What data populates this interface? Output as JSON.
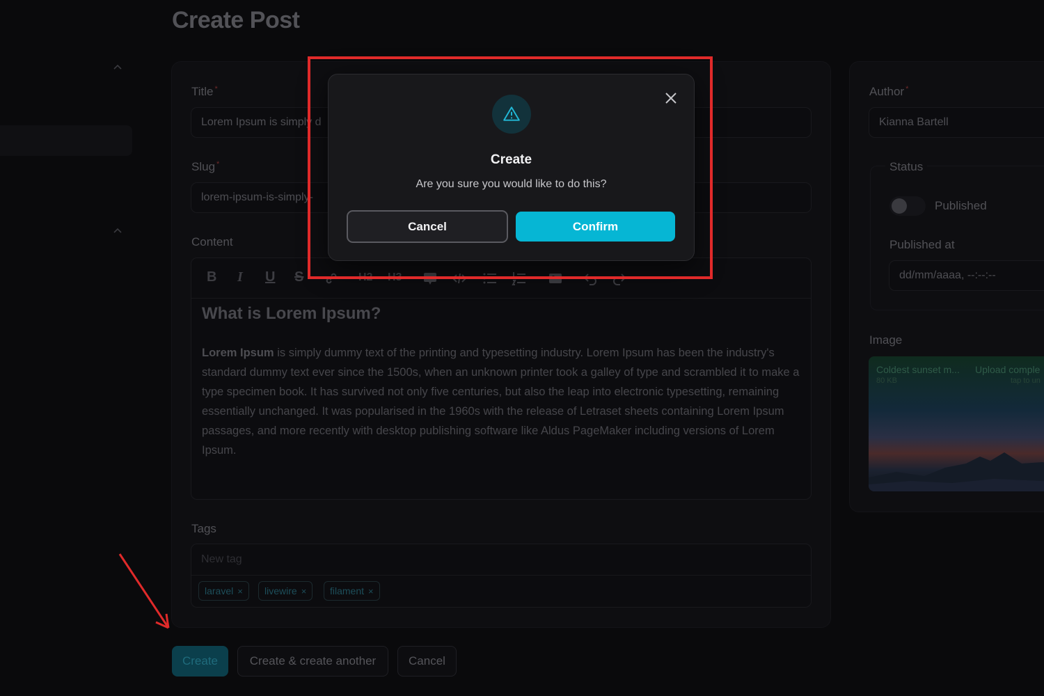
{
  "page": {
    "title": "Create Post"
  },
  "form": {
    "title_label": "Title",
    "title_value": "Lorem Ipsum is simply d",
    "slug_label": "Slug",
    "slug_value": "lorem-ipsum-is-simply-",
    "content_label": "Content",
    "content_heading": "What is Lorem Ipsum?",
    "content_lead": "Lorem Ipsum",
    "content_body": " is simply dummy text of the printing and typesetting industry. Lorem Ipsum has been the industry's standard dummy text ever since the 1500s, when an unknown printer took a galley of type and scrambled it to make a type specimen book. It has survived not only five centuries, but also the leap into electronic typesetting, remaining essentially unchanged. It was popularised in the 1960s with the release of Letraset sheets containing Lorem Ipsum passages, and more recently with desktop publishing software like Aldus PageMaker including versions of Lorem Ipsum.",
    "tags_label": "Tags",
    "tags_placeholder": "New tag",
    "tags": [
      "laravel",
      "livewire",
      "filament"
    ],
    "tag_remove": "×"
  },
  "toolbar": {
    "bold": "B",
    "italic": "I",
    "underline": "U",
    "strike": "S",
    "h2": "H2",
    "h3": "H3"
  },
  "sidebar_panel": {
    "author_label": "Author",
    "author_value": "Kianna Bartell",
    "status_label": "Status",
    "published_label": "Published",
    "published_at_label": "Published at",
    "published_at_placeholder": "dd/mm/aaaa, --:--:--",
    "image_label": "Image",
    "image_file_name": "Coldest sunset m...",
    "image_file_size": "80 KB",
    "image_upload_status": "Upload comple",
    "image_upload_hint": "tap to un"
  },
  "actions": {
    "create": "Create",
    "create_another": "Create & create another",
    "cancel": "Cancel"
  },
  "modal": {
    "title": "Create",
    "description": "Are you sure you would like to do this?",
    "cancel": "Cancel",
    "confirm": "Confirm",
    "icon": "warning-triangle-icon",
    "accent_color": "#06b6d4"
  },
  "colors": {
    "background": "#0a0a0c",
    "primary": "#06b6d4",
    "annotation": "#e02a2a"
  }
}
